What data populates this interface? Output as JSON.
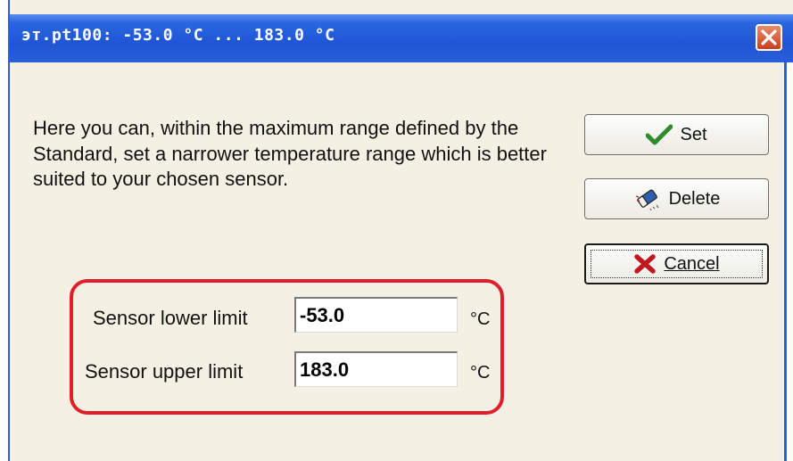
{
  "window": {
    "title": "эт.pt100: -53.0 °C ... 183.0 °C",
    "close_icon": "close-icon"
  },
  "description": "Here you can, within the maximum range defined by the Standard, set a narrower temperature range which is better suited to your chosen sensor.",
  "buttons": {
    "set": {
      "label": "Set",
      "icon": "checkmark-icon"
    },
    "delete": {
      "label": "Delete",
      "icon": "eraser-icon"
    },
    "cancel": {
      "label": "Cancel",
      "icon": "x-cross-icon"
    }
  },
  "limits": {
    "lower": {
      "label": "Sensor lower limit",
      "value": "-53.0",
      "unit": "°C"
    },
    "upper": {
      "label": "Sensor upper limit",
      "value": "183.0",
      "unit": "°C"
    }
  },
  "colors": {
    "titlebar": "#2a66e0",
    "highlight_border": "#e01e2a",
    "check": "#2e8b2e",
    "cancel_x": "#c0181f"
  }
}
